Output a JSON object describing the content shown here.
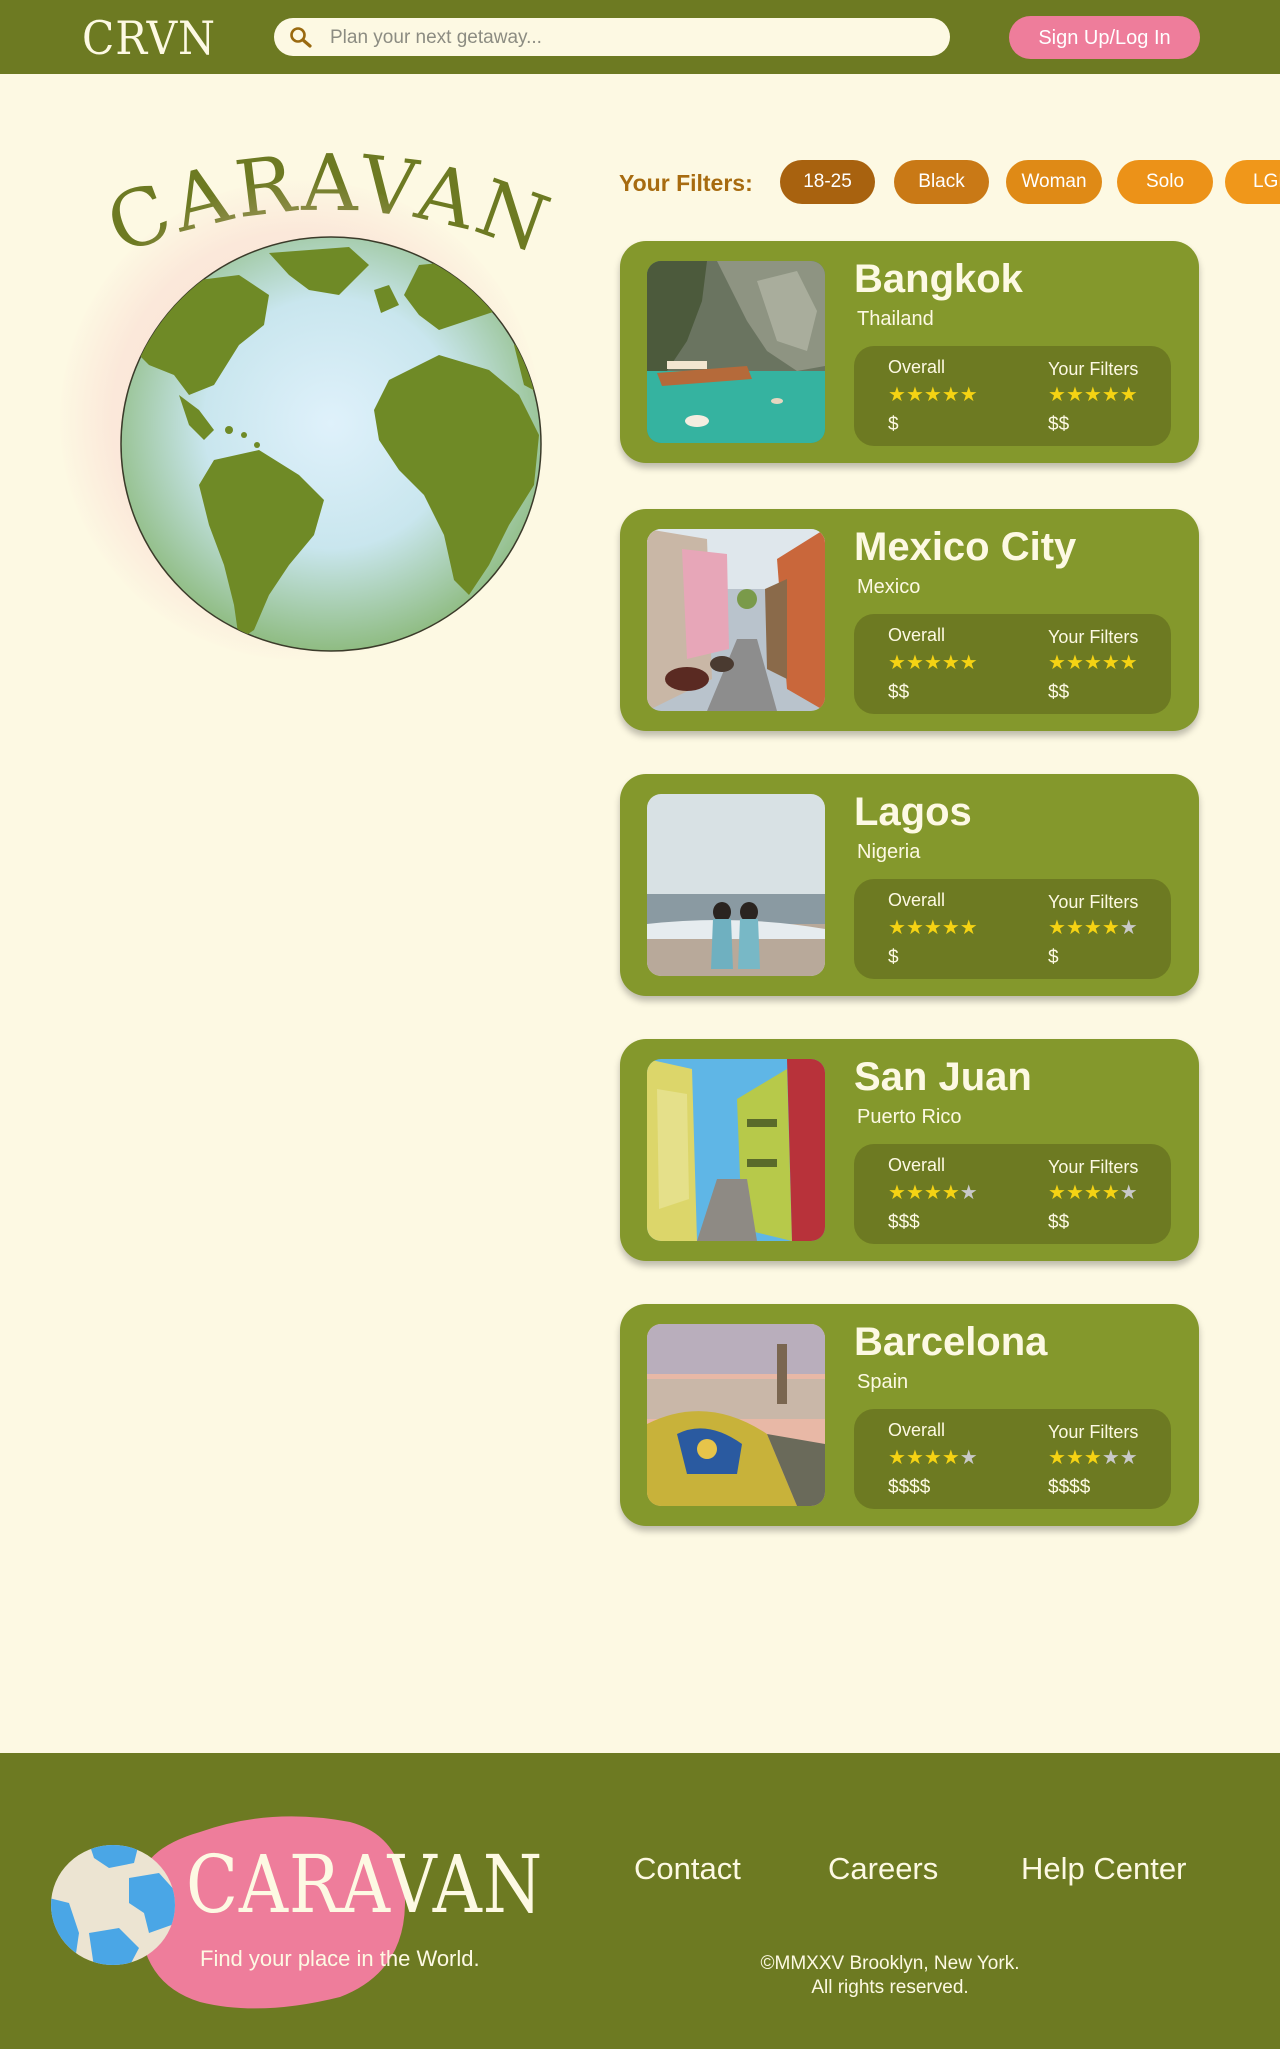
{
  "header": {
    "logo": "CRVN",
    "search_placeholder": "Plan your next getaway...",
    "signup_label": "Sign Up/Log In"
  },
  "hero": {
    "title": "CARAVAN"
  },
  "filters": {
    "label": "Your Filters:",
    "chips": [
      {
        "label": "18-25",
        "color": "#a8620f"
      },
      {
        "label": "Black",
        "color": "#c97916"
      },
      {
        "label": "Woman",
        "color": "#df8a16"
      },
      {
        "label": "Solo",
        "color": "#ec9218"
      },
      {
        "label": "LGBTQ+",
        "color": "#f0971a"
      }
    ]
  },
  "rating_labels": {
    "overall": "Overall",
    "your_filters": "Your Filters"
  },
  "destinations": [
    {
      "city": "Bangkok",
      "country": "Thailand",
      "overall_stars": 5,
      "overall_price": "$",
      "filter_stars": 5,
      "filter_price": "$$"
    },
    {
      "city": "Mexico City",
      "country": "Mexico",
      "overall_stars": 5,
      "overall_price": "$$",
      "filter_stars": 5,
      "filter_price": "$$"
    },
    {
      "city": "Lagos",
      "country": "Nigeria",
      "overall_stars": 5,
      "overall_price": "$",
      "filter_stars": 4,
      "filter_price": "$"
    },
    {
      "city": "San Juan",
      "country": "Puerto Rico",
      "overall_stars": 4,
      "overall_price": "$$$",
      "filter_stars": 4,
      "filter_price": "$$"
    },
    {
      "city": "Barcelona",
      "country": "Spain",
      "overall_stars": 4,
      "overall_price": "$$$$",
      "filter_stars": 3,
      "filter_price": "$$$$"
    }
  ],
  "footer": {
    "brand": "CARAVAN",
    "tagline": "Find your place in the World.",
    "links": [
      "Contact",
      "Careers",
      "Help Center"
    ],
    "copyright_line1": "©MMXXV Brooklyn, New York.",
    "copyright_line2": "All rights reserved."
  },
  "colors": {
    "background": "#fdf9e3",
    "header": "#6d7a22",
    "card": "#84982c",
    "rating_panel": "#6d7a22",
    "signup": "#ee7d9b",
    "star": "#f5d313",
    "filter_label": "#a76b10"
  }
}
